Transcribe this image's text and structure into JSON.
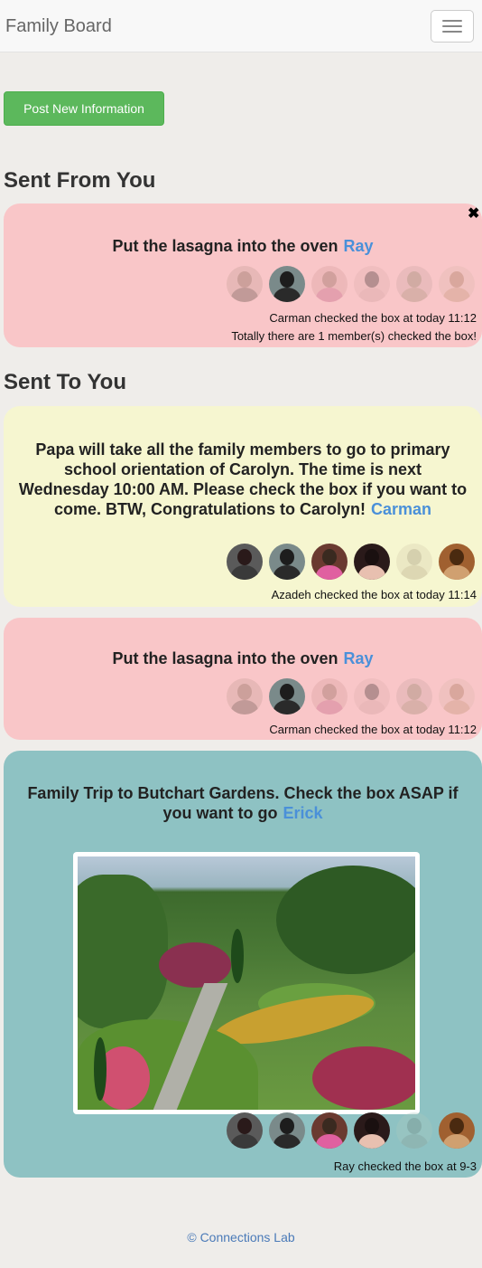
{
  "navbar": {
    "brand": "Family Board"
  },
  "post_button": {
    "label": "Post New Information"
  },
  "sent_from_you": {
    "title": "Sent From You",
    "cards": [
      {
        "message": "Put the lasagna into the oven",
        "author": "Ray",
        "status": "Carman checked the box at today 11:12",
        "summary": "Totally there are 1 member(s) checked the box!"
      }
    ]
  },
  "sent_to_you": {
    "title": "Sent To You",
    "cards": [
      {
        "message": "Papa will take all the family members to go to primary school orientation of Carolyn. The time is next Wednesday 10:00 AM. Please check the box if you want to come. BTW, Congratulations to Carolyn!",
        "author": "Carman",
        "status": "Azadeh checked the box at today 11:14"
      },
      {
        "message": "Put the lasagna into the oven",
        "author": "Ray",
        "status": "Carman checked the box at today 11:12"
      },
      {
        "message": "Family Trip to Butchart Gardens. Check the box ASAP if you want to go",
        "author": "Erick",
        "status": "Ray checked the box at 9-3"
      }
    ]
  },
  "footer": {
    "text": "© Connections Lab"
  },
  "colors": {
    "pink_card": "#f9c6c8",
    "yellow_card": "#f6f6d0",
    "teal_card": "#8ec2c3",
    "author_link": "#4a90d9",
    "button": "#5cb85c"
  }
}
